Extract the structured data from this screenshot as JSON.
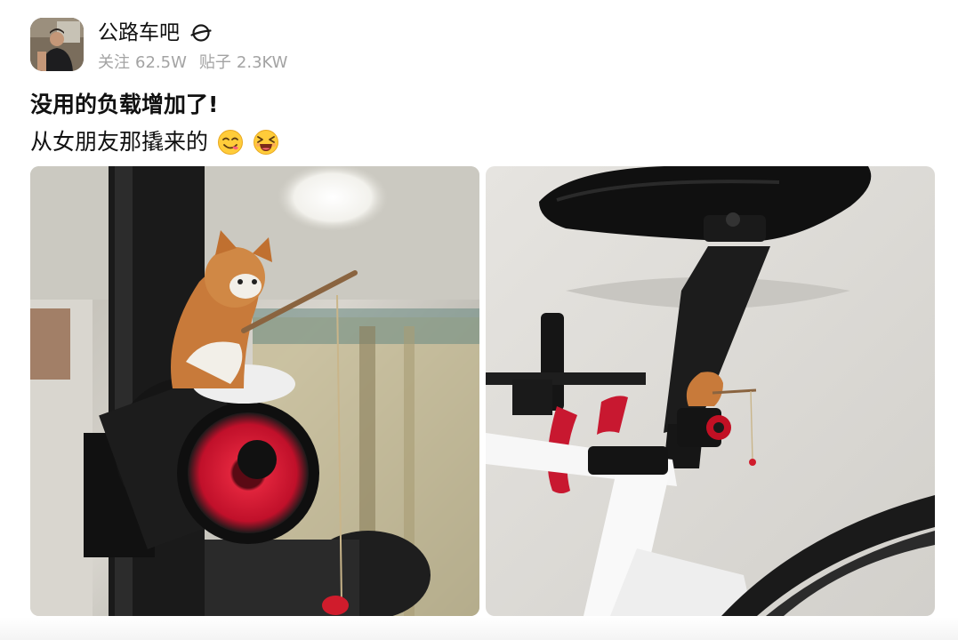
{
  "header": {
    "forum_name": "公路车吧",
    "badge_icon": "planet-icon",
    "stats": {
      "follow_label": "关注",
      "follow_count": "62.5W",
      "posts_label": "贴子",
      "posts_count": "2.3KW"
    }
  },
  "post": {
    "title": "没用的负载增加了!",
    "body": "从女朋友那撬来的",
    "emojis": [
      "yum-face-icon",
      "grinning-squint-face-icon"
    ]
  },
  "photos": [
    {
      "subject": "cat-figurine-fishing-on-bike-tail-light-closeup"
    },
    {
      "subject": "cat-figurine-fishing-on-bike-seatpost-wide"
    }
  ],
  "colors": {
    "text": "#111111",
    "muted": "#a3a3a3",
    "light_red": "#d0142c"
  }
}
